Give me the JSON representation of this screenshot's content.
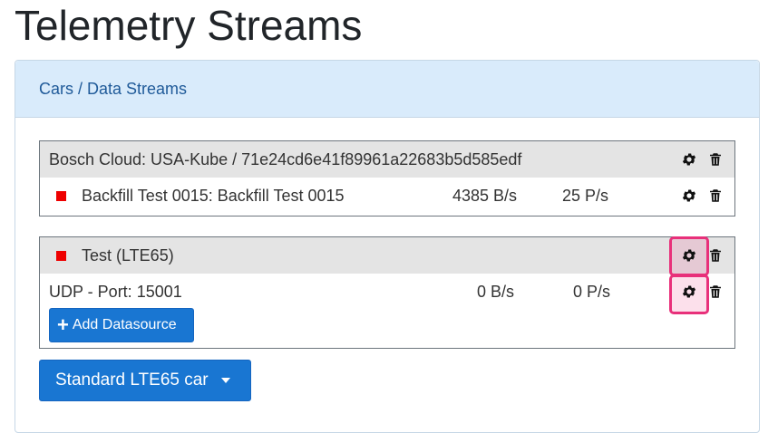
{
  "page": {
    "title": "Telemetry Streams"
  },
  "breadcrumb": "Cars / Data Streams",
  "groups": [
    {
      "header": "Bosch Cloud: USA-Kube / 71e24cd6e41f89961a22683b5d585edf",
      "streams": [
        {
          "name": "Backfill Test 0015: Backfill Test 0015",
          "rate": "4385 B/s",
          "packets": "25 P/s",
          "status_color": "#ee0000"
        }
      ]
    },
    {
      "header": "Test (LTE65)",
      "header_status_color": "#ee0000",
      "streams": [
        {
          "name": "UDP - Port: 15001",
          "rate": "0 B/s",
          "packets": "0 P/s"
        }
      ],
      "add_button_label": "Add Datasource"
    }
  ],
  "car_dropdown": {
    "selected": "Standard LTE65 car"
  },
  "icons": {
    "settings": "gear-icon",
    "delete": "trash-icon",
    "add": "plus-icon",
    "dropdown": "caret-down-icon"
  },
  "colors": {
    "primary_button": "#1976d2",
    "panel_header": "#d9ebfb",
    "status_inactive": "#ee0000",
    "highlight": "#e8307a"
  }
}
